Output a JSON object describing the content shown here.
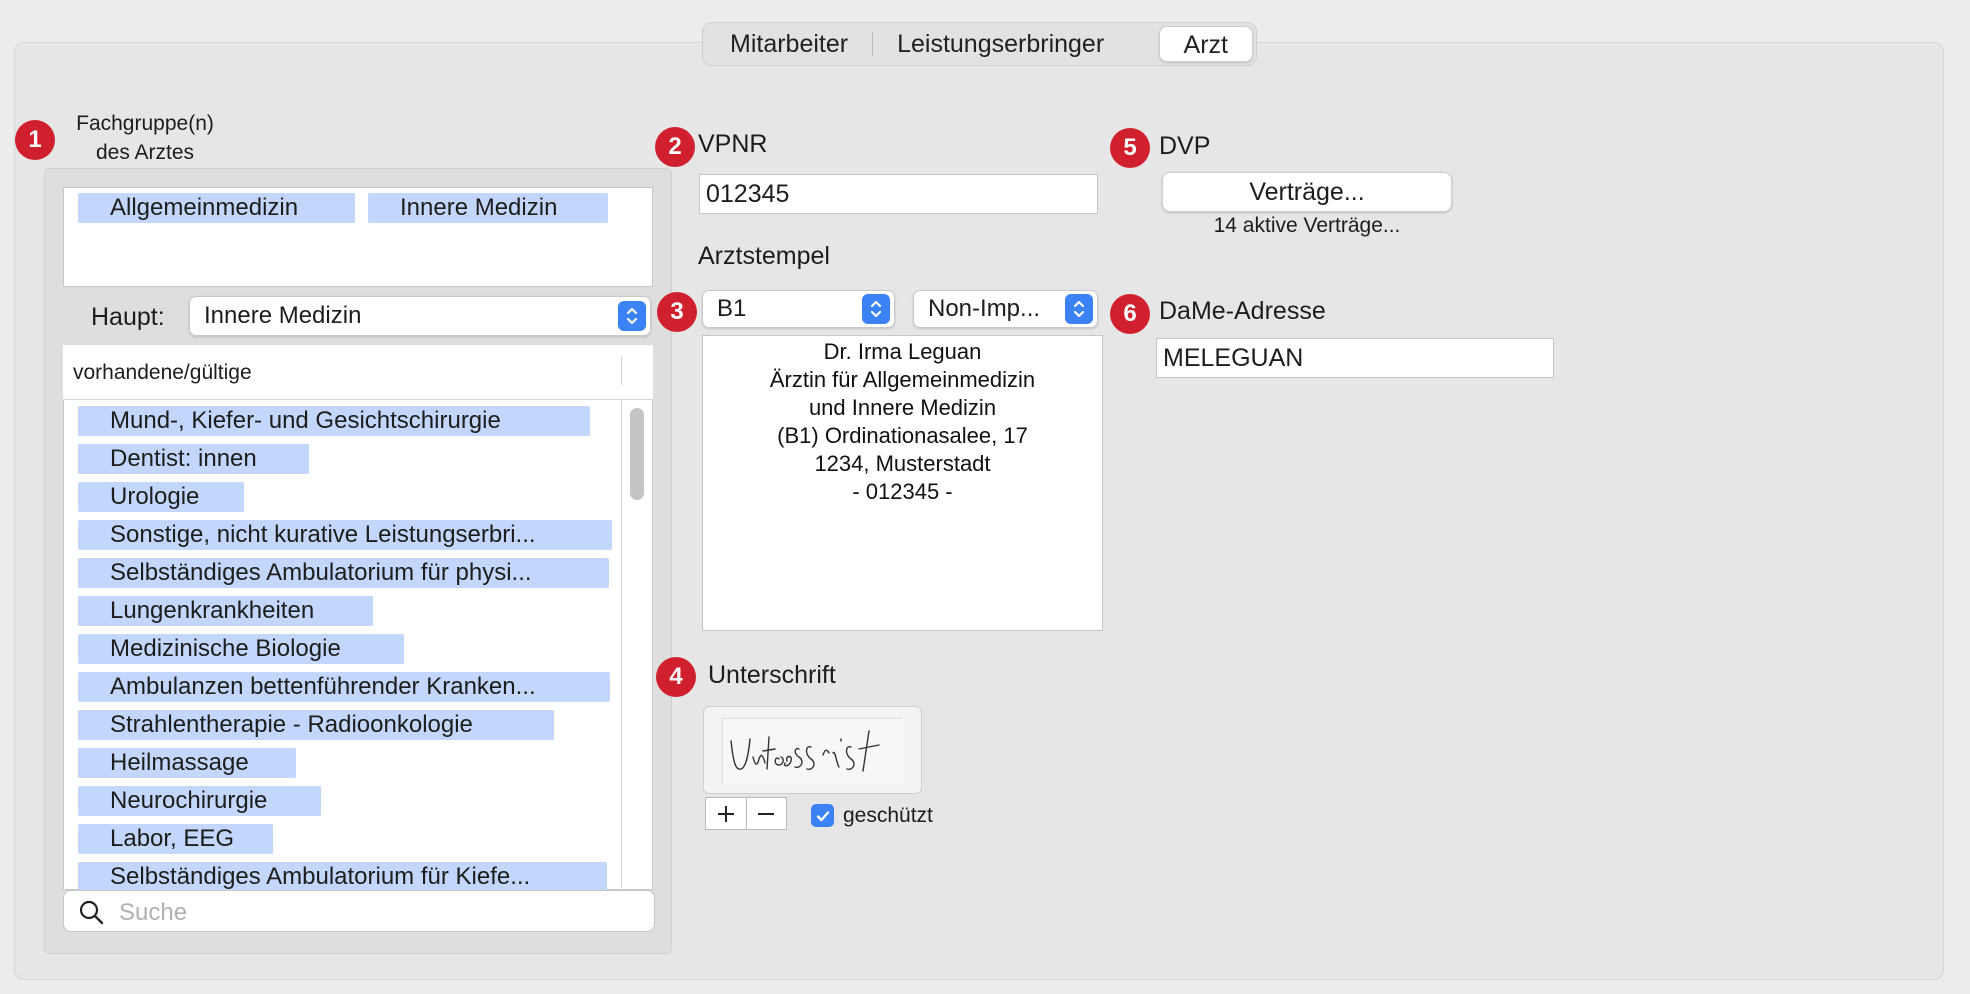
{
  "tabs": [
    "Mitarbeiter",
    "Leistungserbringer",
    "Arzt"
  ],
  "active_tab": "Arzt",
  "badges": [
    "1",
    "2",
    "3",
    "4",
    "5",
    "6"
  ],
  "fachgruppe": {
    "label_line1": "Fachgruppe(n)",
    "label_line2": "des Arztes",
    "selected_tags": [
      "Allgemeinmedizin",
      "Innere Medizin"
    ],
    "haupt_label": "Haupt:",
    "haupt_value": "Innere Medizin",
    "list_header": "vorhandene/gültige",
    "list_items": [
      "Mund-, Kiefer- und Gesichtschirurgie",
      "Dentist: innen",
      "Urologie",
      "Sonstige, nicht kurative Leistungserbri...",
      "Selbständiges Ambulatorium für physi...",
      "Lungenkrankheiten",
      "Medizinische Biologie",
      "Ambulanzen bettenführender Kranken...",
      "Strahlentherapie - Radioonkologie",
      "Heilmassage",
      "Neurochirurgie",
      "Labor, EEG",
      "Selbständiges Ambulatorium für Kiefe..."
    ],
    "search_placeholder": "Suche"
  },
  "vpnr": {
    "label": "VPNR",
    "value": "012345"
  },
  "arztstempel": {
    "label": "Arztstempel",
    "stamp_select": "B1",
    "import_select": "Non-Imp...",
    "stamp_lines": [
      "Dr. Irma Leguan",
      "Ärztin für Allgemeinmedizin",
      "und Innere Medizin",
      "(B1) Ordinationasalee, 17",
      "1234, Musterstadt",
      "- 012345 -"
    ]
  },
  "unterschrift": {
    "label": "Unterschrift",
    "signature_text": "Unterschrift",
    "add_symbol": "+",
    "remove_symbol": "—",
    "protected_label": "geschützt",
    "protected_checked": true
  },
  "dvp": {
    "label": "DVP",
    "button_label": "Verträge...",
    "status": "14 aktive Verträge..."
  },
  "dame": {
    "label": "DaMe-Adresse",
    "value": "MELEGUAN"
  },
  "colors": {
    "badge": "#d0202e",
    "tag_bg": "#c3d6fb",
    "accent": "#3b82f6"
  }
}
